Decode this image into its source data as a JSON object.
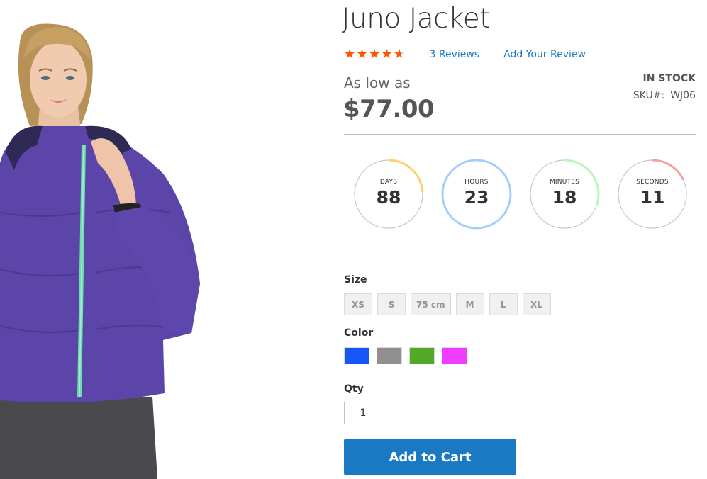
{
  "product": {
    "name": "Juno Jacket",
    "image_icon": "product-photo-jacket",
    "rating_percent": 0.9,
    "reviews_link": "3  Reviews",
    "add_review_link": "Add Your Review",
    "price_prefix": "As low as",
    "price": "$77.00",
    "stock": "In stock",
    "sku_label": "SKU#:",
    "sku_value": "WJ06"
  },
  "countdown": {
    "days": {
      "label": "DAYS",
      "value": "88",
      "color": "#fdd06e",
      "progress": 0.24
    },
    "hours": {
      "label": "HOURS",
      "value": "23",
      "color": "#a5cefa",
      "progress": 1.0
    },
    "minutes": {
      "label": "MINUTES",
      "value": "18",
      "color": "#b9f7b9",
      "progress": 0.3
    },
    "seconds": {
      "label": "SECONDS",
      "value": "11",
      "color": "#f5a29f",
      "progress": 0.18
    }
  },
  "options": {
    "size_label": "Size",
    "sizes": [
      "XS",
      "S",
      "75 cm",
      "M",
      "L",
      "XL"
    ],
    "color_label": "Color",
    "colors": [
      {
        "name": "Blue",
        "hex": "#1857f7"
      },
      {
        "name": "Gray",
        "hex": "#8f8f8f"
      },
      {
        "name": "Green",
        "hex": "#53a828"
      },
      {
        "name": "Purple",
        "hex": "#ef3dff"
      }
    ],
    "qty_label": "Qty",
    "qty_value": "1"
  },
  "actions": {
    "add_to_cart": "Add to Cart"
  },
  "theme": {
    "accent": "#1979c3",
    "star": "#ff5501"
  }
}
